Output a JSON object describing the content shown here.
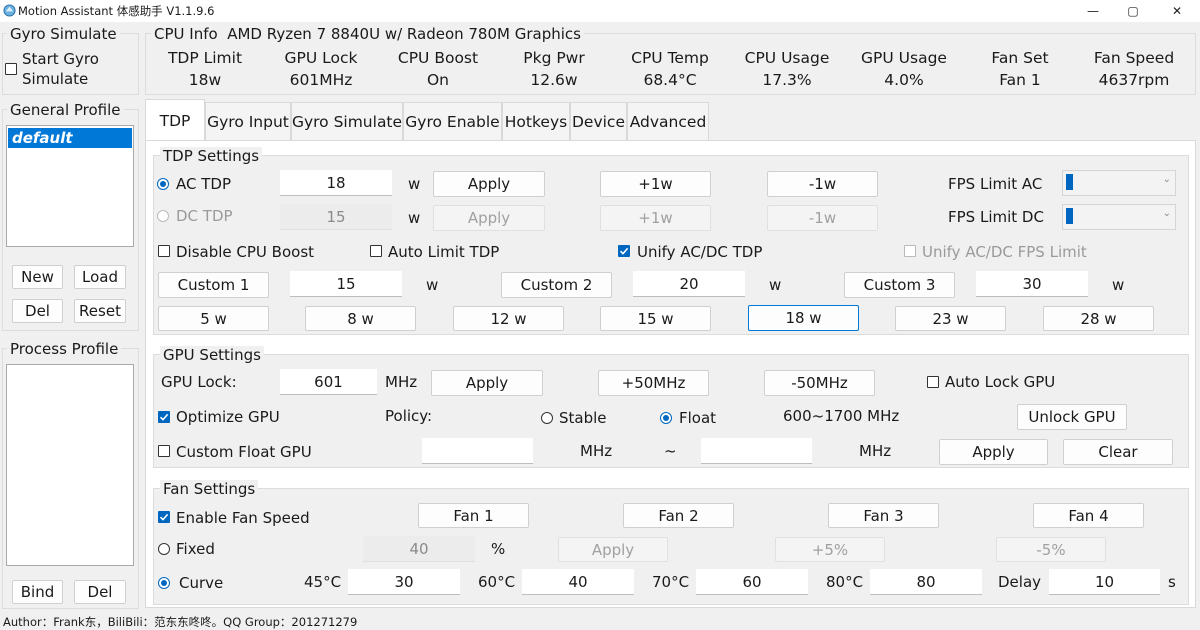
{
  "window": {
    "title": "Motion Assistant 体感助手 V1.1.9.6",
    "min_glyph": "—",
    "max_glyph": "▢",
    "close_glyph": "✕"
  },
  "gyro_simulate": {
    "title": "Gyro Simulate",
    "checkbox_label_1": "Start Gyro",
    "checkbox_label_2": "Simulate",
    "checked": false
  },
  "general_profile": {
    "title": "General Profile",
    "items": [
      "default"
    ],
    "selected": "default",
    "buttons": {
      "new": "New",
      "load": "Load",
      "del": "Del",
      "reset": "Reset"
    }
  },
  "process_profile": {
    "title": "Process Profile",
    "items": [],
    "buttons": {
      "bind": "Bind",
      "del": "Del"
    }
  },
  "cpu_info": {
    "title": "CPU Info",
    "cpu_name": "AMD Ryzen 7 8840U w/ Radeon 780M Graphics",
    "columns": [
      {
        "label": "TDP Limit",
        "value": "18w"
      },
      {
        "label": "GPU Lock",
        "value": "601MHz"
      },
      {
        "label": "CPU Boost",
        "value": "On"
      },
      {
        "label": "Pkg Pwr",
        "value": "12.6w"
      },
      {
        "label": "CPU Temp",
        "value": "68.4°C"
      },
      {
        "label": "CPU Usage",
        "value": "17.3%"
      },
      {
        "label": "GPU Usage",
        "value": "4.0%"
      },
      {
        "label": "Fan Set",
        "value": "Fan 1"
      },
      {
        "label": "Fan Speed",
        "value": "4637rpm"
      }
    ]
  },
  "tabs": [
    {
      "label": "TDP",
      "active": true
    },
    {
      "label": "Gyro Input",
      "active": false
    },
    {
      "label": "Gyro Simulate",
      "active": false
    },
    {
      "label": "Gyro Enable",
      "active": false
    },
    {
      "label": "Hotkeys",
      "active": false
    },
    {
      "label": "Device",
      "active": false
    },
    {
      "label": "Advanced",
      "active": false
    }
  ],
  "tdp_settings": {
    "title": "TDP Settings",
    "ac": {
      "label": "AC TDP",
      "value": "18",
      "unit": "w",
      "apply": "Apply",
      "plus": "+1w",
      "minus": "-1w",
      "selected": true
    },
    "dc": {
      "label": "DC TDP",
      "value": "15",
      "unit": "w",
      "apply": "Apply",
      "plus": "+1w",
      "minus": "-1w",
      "selected": false,
      "disabled": true
    },
    "fps_limit_ac": {
      "label": "FPS Limit AC"
    },
    "fps_limit_dc": {
      "label": "FPS Limit DC"
    },
    "disable_cpu_boost": {
      "label": "Disable CPU Boost",
      "checked": false
    },
    "auto_limit_tdp": {
      "label": "Auto Limit TDP",
      "checked": false
    },
    "unify_ac_dc_tdp": {
      "label": "Unify AC/DC TDP",
      "checked": true
    },
    "unify_fps_limit": {
      "label": "Unify AC/DC FPS Limit",
      "checked": false,
      "disabled": true
    },
    "customs": [
      {
        "label": "Custom 1",
        "value": "15",
        "unit": "w"
      },
      {
        "label": "Custom 2",
        "value": "20",
        "unit": "w"
      },
      {
        "label": "Custom 3",
        "value": "30",
        "unit": "w"
      }
    ],
    "presets": [
      {
        "label": "5 w",
        "selected": false
      },
      {
        "label": "8 w",
        "selected": false
      },
      {
        "label": "12 w",
        "selected": false
      },
      {
        "label": "15 w",
        "selected": false
      },
      {
        "label": "18 w",
        "selected": true
      },
      {
        "label": "23 w",
        "selected": false
      },
      {
        "label": "28 w",
        "selected": false
      }
    ]
  },
  "gpu_settings": {
    "title": "GPU Settings",
    "lock_label": "GPU Lock:",
    "lock_value": "601",
    "lock_unit": "MHz",
    "apply": "Apply",
    "plus": "+50MHz",
    "minus": "-50MHz",
    "auto_lock": {
      "label": "Auto Lock GPU",
      "checked": false
    },
    "optimize": {
      "label": "Optimize GPU",
      "checked": true
    },
    "policy_label": "Policy:",
    "policy_stable": {
      "label": "Stable",
      "selected": false
    },
    "policy_float": {
      "label": "Float",
      "selected": true
    },
    "range": "600~1700 MHz",
    "unlock": "Unlock GPU",
    "custom_float": {
      "label": "Custom Float GPU",
      "checked": false
    },
    "float_min": "",
    "float_max": "",
    "float_unit_1": "MHz",
    "float_sep": "~",
    "float_unit_2": "MHz",
    "float_apply": "Apply",
    "float_clear": "Clear"
  },
  "fan_settings": {
    "title": "Fan Settings",
    "enable": {
      "label": "Enable Fan Speed",
      "checked": true
    },
    "fans": [
      "Fan 1",
      "Fan 2",
      "Fan 3",
      "Fan 4"
    ],
    "fixed": {
      "label": "Fixed",
      "selected": false,
      "value": "40",
      "unit": "%",
      "apply": "Apply",
      "plus": "+5%",
      "minus": "-5%"
    },
    "curve": {
      "label": "Curve",
      "selected": true,
      "points": [
        {
          "temp": "45°C",
          "value": "30"
        },
        {
          "temp": "60°C",
          "value": "40"
        },
        {
          "temp": "70°C",
          "value": "60"
        },
        {
          "temp": "80°C",
          "value": "80"
        }
      ],
      "delay_label": "Delay",
      "delay_value": "10",
      "delay_unit": "s"
    }
  },
  "footer": {
    "text": "Author：Frank东，BiliBili：范东东咚咚。QQ Group：201271279"
  }
}
